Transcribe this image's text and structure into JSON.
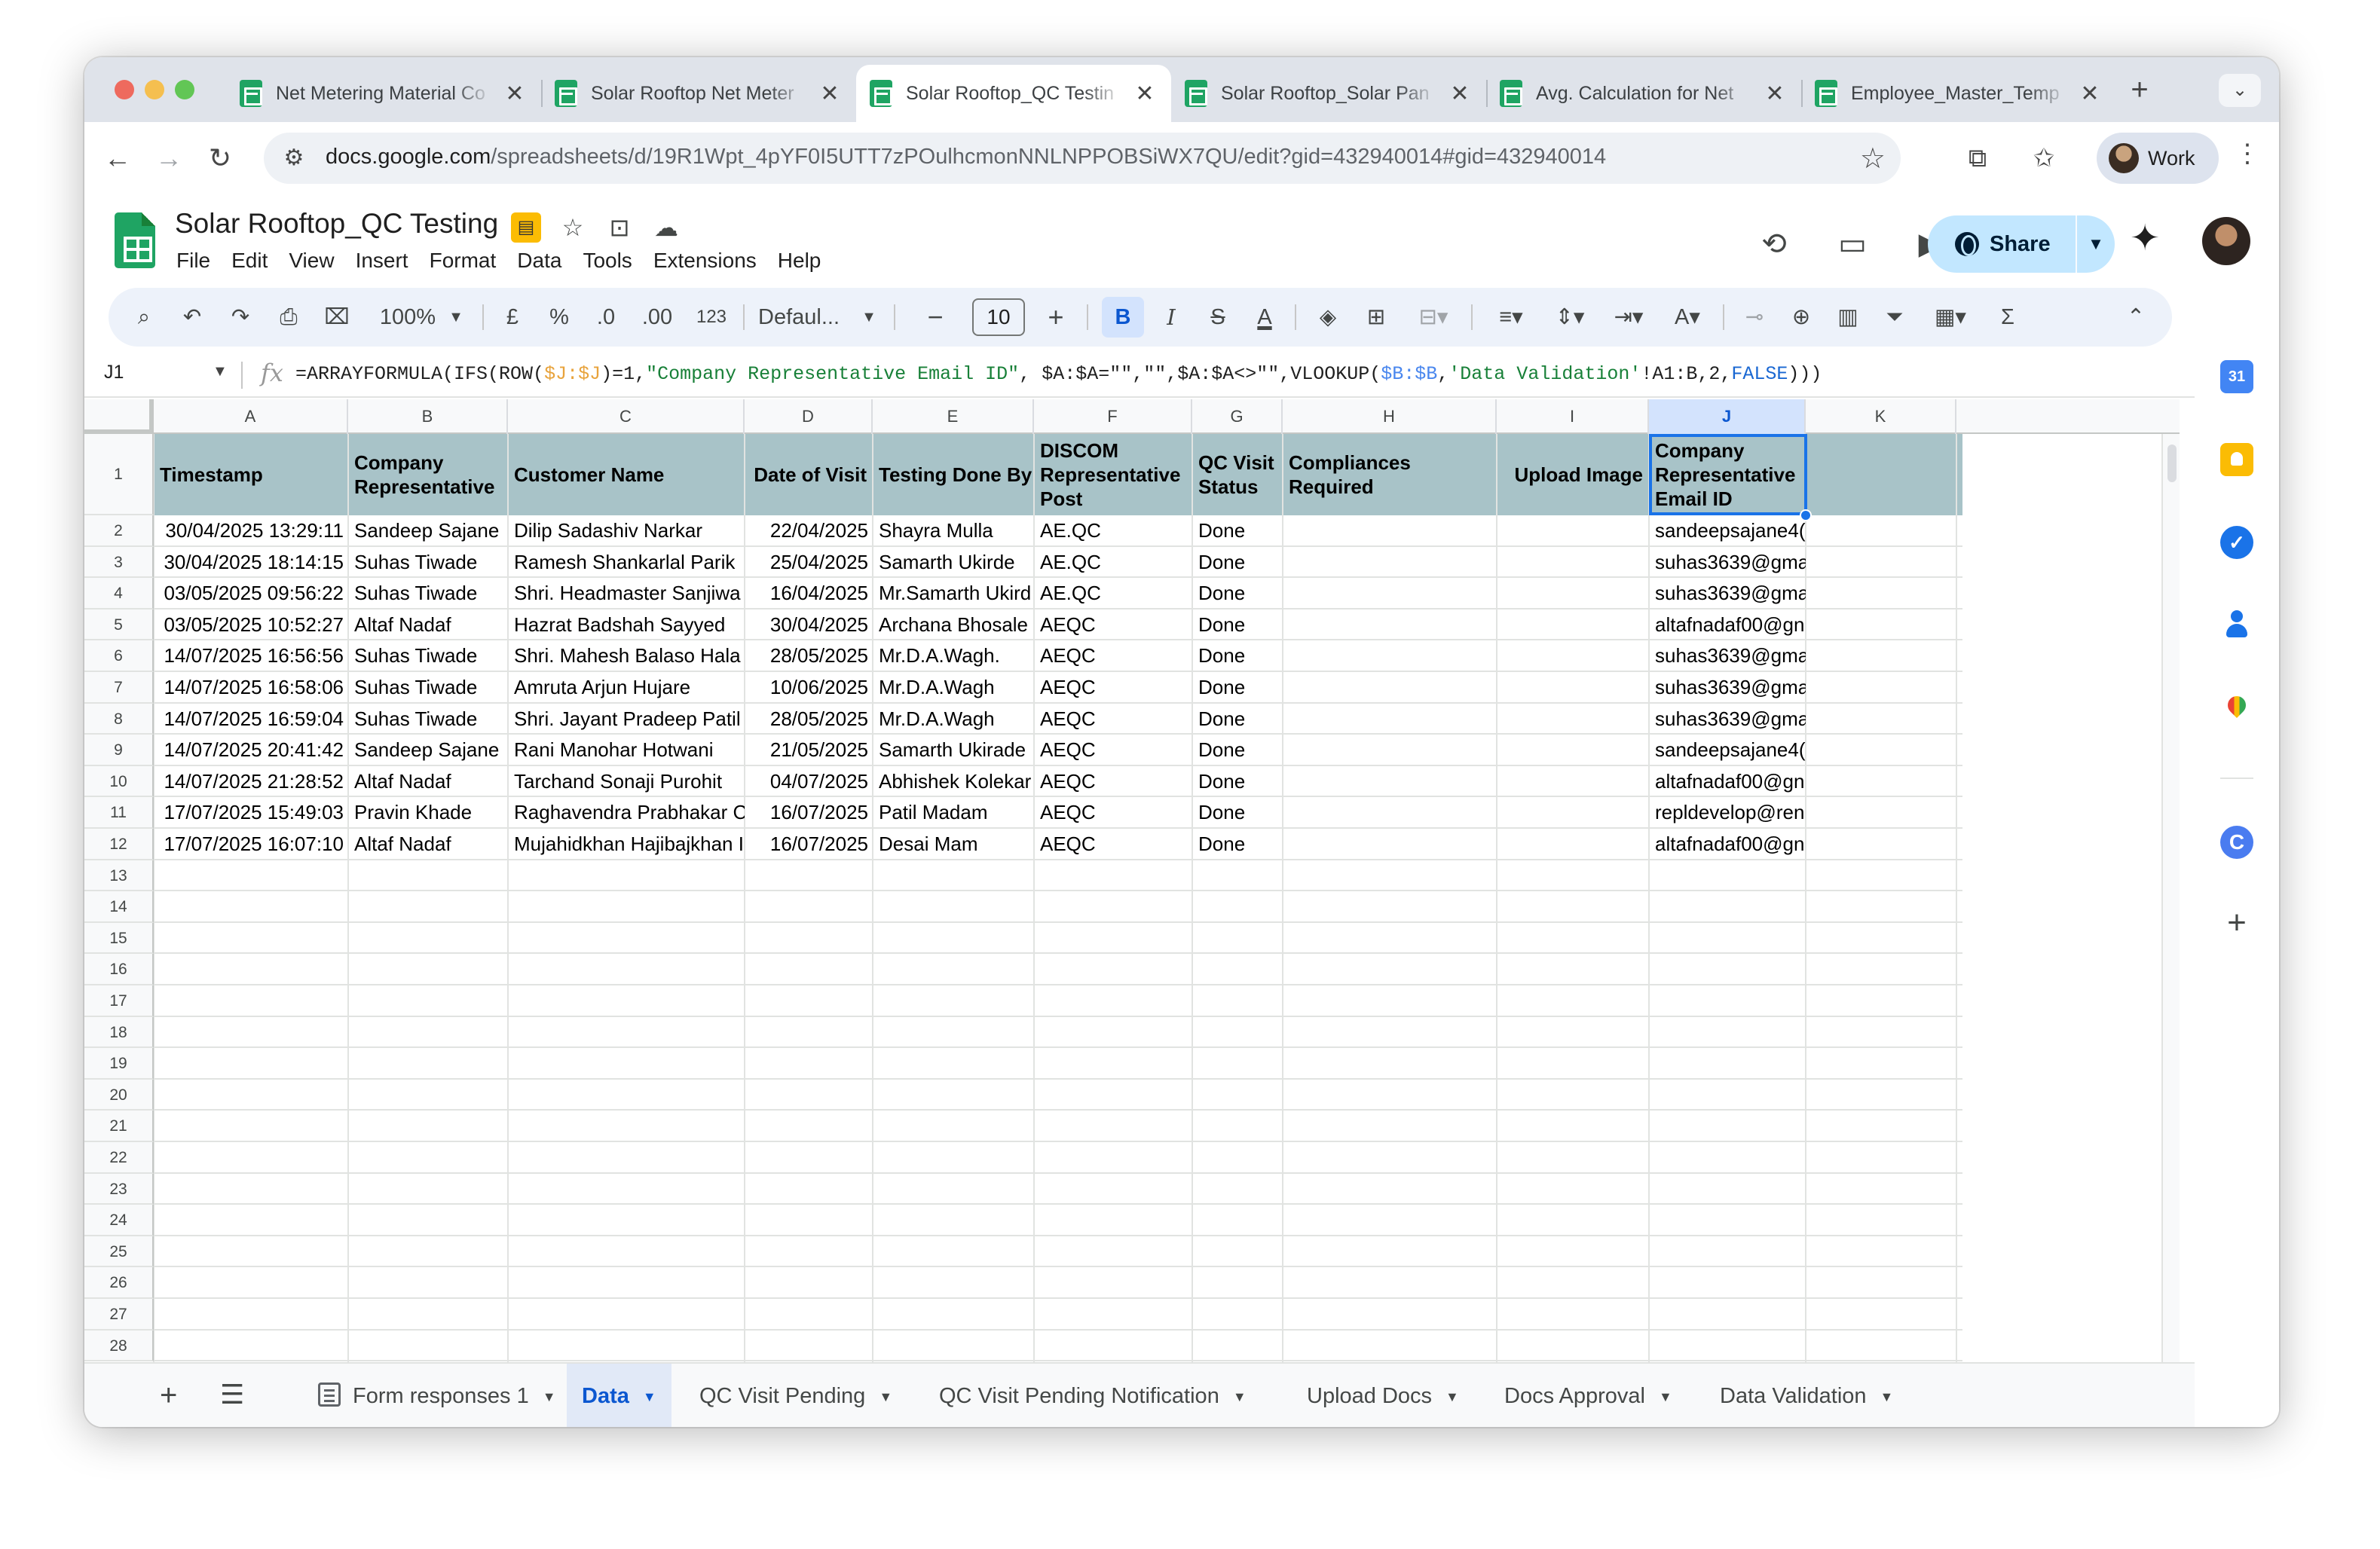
{
  "browser": {
    "tabs": [
      {
        "title": "Net Metering Material Co"
      },
      {
        "title": "Solar Rooftop Net Meter"
      },
      {
        "title": "Solar Rooftop_QC Testin"
      },
      {
        "title": "Solar Rooftop_Solar Pan"
      },
      {
        "title": "Avg. Calculation for Net"
      },
      {
        "title": "Employee_Master_Temp"
      }
    ],
    "active_tab": 2,
    "close_glyph": "✕",
    "newtab_glyph": "+",
    "tablist_glyph": "⌄",
    "url_host": "docs.google.com",
    "url_path": "/spreadsheets/d/19R1Wpt_4pYF0I5UTT7zPOulhcmonNNLNPPOBSiWX7QU/edit?gid=432940014#gid=432940014",
    "profile_label": "Work"
  },
  "doc": {
    "title": "Solar Rooftop_QC Testing",
    "menu": [
      "File",
      "Edit",
      "View",
      "Insert",
      "Format",
      "Data",
      "Tools",
      "Extensions",
      "Help"
    ],
    "share_label": "Share"
  },
  "toolbar": {
    "zoom": "100%",
    "currency": "£",
    "percent": "%",
    "dec_decrease": ".0",
    "dec_increase": ".00",
    "number_format": "123",
    "font": "Defaul...",
    "font_size": "10",
    "bold": "B",
    "italic": "I",
    "strike": "S",
    "text_color": "A",
    "sum": "Σ"
  },
  "formula_bar": {
    "name_box": "J1",
    "fx": "fx",
    "parts": [
      {
        "t": "=ARRAYFORMULA(IFS(ROW(",
        "c": ""
      },
      {
        "t": "$J:$J",
        "c": "ref1"
      },
      {
        "t": ")=1,",
        "c": ""
      },
      {
        "t": "\"Company Representative Email ID\"",
        "c": "str"
      },
      {
        "t": ", $A:$A=\"\",\"\",$A:$A<>\"\",VLOOKUP(",
        "c": ""
      },
      {
        "t": "$B:$B",
        "c": "ref2"
      },
      {
        "t": ",",
        "c": ""
      },
      {
        "t": "'Data Validation'",
        "c": "str"
      },
      {
        "t": "!A1:B,2,",
        "c": ""
      },
      {
        "t": "FALSE",
        "c": "bool"
      },
      {
        "t": ")))",
        "c": ""
      }
    ]
  },
  "sheet": {
    "columns": [
      "A",
      "B",
      "C",
      "D",
      "E",
      "F",
      "G",
      "H",
      "I",
      "J",
      "K"
    ],
    "selected_column": "J",
    "header_row": [
      "Timestamp",
      "Company Representative",
      "Customer Name",
      "Date of Visit",
      "Testing Done By",
      "DISCOM Representative Post",
      "QC Visit Status",
      "Compliances Required",
      "Upload Image",
      "Company Representative Email ID",
      ""
    ],
    "rows": [
      [
        "30/04/2025 13:29:11",
        "Sandeep Sajane",
        "Dilip Sadashiv Narkar",
        "22/04/2025",
        "Shayra Mulla",
        "AE.QC",
        "Done",
        "",
        "",
        "sandeepsajane4("
      ],
      [
        "30/04/2025 18:14:15",
        "Suhas Tiwade",
        "Ramesh Shankarlal Parik",
        "25/04/2025",
        "Samarth Ukirde",
        "AE.QC",
        "Done",
        "",
        "",
        "suhas3639@gma"
      ],
      [
        "03/05/2025 09:56:22",
        "Suhas Tiwade",
        "Shri. Headmaster Sanjiwa",
        "16/04/2025",
        "Mr.Samarth Ukird",
        "AE.QC",
        "Done",
        "",
        "",
        "suhas3639@gma"
      ],
      [
        "03/05/2025 10:52:27",
        "Altaf Nadaf",
        "Hazrat Badshah Sayyed",
        "30/04/2025",
        "Archana Bhosale",
        "AEQC",
        "Done",
        "",
        "",
        "altafnadaf00@gn"
      ],
      [
        "14/07/2025 16:56:56",
        "Suhas Tiwade",
        "Shri. Mahesh Balaso Hala",
        "28/05/2025",
        "Mr.D.A.Wagh.",
        "AEQC",
        "Done",
        "",
        "",
        "suhas3639@gma"
      ],
      [
        "14/07/2025 16:58:06",
        "Suhas Tiwade",
        "Amruta Arjun Hujare",
        "10/06/2025",
        "Mr.D.A.Wagh",
        "AEQC",
        "Done",
        "",
        "",
        "suhas3639@gma"
      ],
      [
        "14/07/2025 16:59:04",
        "Suhas Tiwade",
        "Shri. Jayant Pradeep Patil",
        "28/05/2025",
        "Mr.D.A.Wagh",
        "AEQC",
        "Done",
        "",
        "",
        "suhas3639@gma"
      ],
      [
        "14/07/2025 20:41:42",
        "Sandeep Sajane",
        "Rani Manohar Hotwani",
        "21/05/2025",
        "Samarth Ukirade",
        "AEQC",
        "Done",
        "",
        "",
        "sandeepsajane4("
      ],
      [
        "14/07/2025 21:28:52",
        "Altaf Nadaf",
        "Tarchand Sonaji Purohit",
        "04/07/2025",
        "Abhishek Kolekar",
        "AEQC",
        "Done",
        "",
        "",
        "altafnadaf00@gn"
      ],
      [
        "17/07/2025 15:49:03",
        "Pravin Khade",
        "Raghavendra Prabhakar C",
        "16/07/2025",
        "Patil Madam",
        "AEQC",
        "Done",
        "",
        "",
        "repldevelop@ren"
      ],
      [
        "17/07/2025 16:07:10",
        "Altaf Nadaf",
        "Mujahidkhan Hajibajkhan I",
        "16/07/2025",
        "Desai Mam",
        "AEQC",
        "Done",
        "",
        "",
        "altafnadaf00@gn"
      ]
    ],
    "row_numbers": [
      "1",
      "2",
      "3",
      "4",
      "5",
      "6",
      "7",
      "8",
      "9",
      "10",
      "11",
      "12",
      "13",
      "14",
      "15",
      "16",
      "17",
      "18",
      "19",
      "20",
      "21",
      "22",
      "23",
      "24",
      "25",
      "26",
      "27",
      "28"
    ],
    "header_band_color": "#a8c3c8"
  },
  "sheet_tabs": {
    "add_glyph": "+",
    "list_glyph": "☰",
    "tabs": [
      "Form responses 1",
      "Data",
      "QC Visit Pending",
      "QC Visit Pending Notification",
      "Upload Docs",
      "Docs Approval",
      "Data Validation"
    ],
    "active": "Data"
  },
  "side_panel": {
    "calendar_label": "31",
    "addon_label": "C"
  }
}
